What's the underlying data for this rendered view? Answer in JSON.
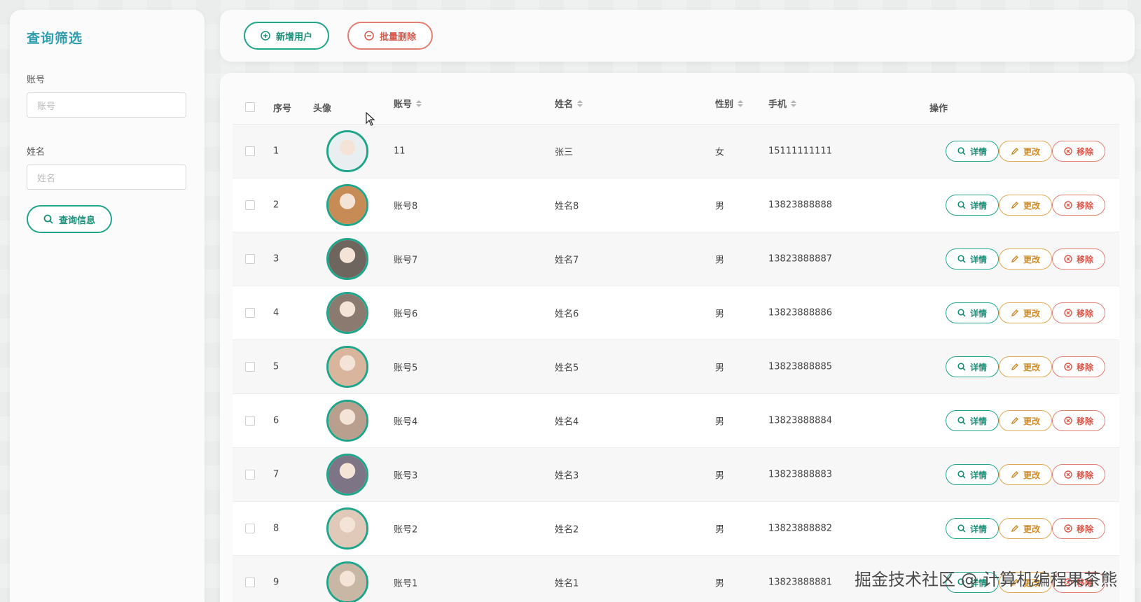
{
  "sidebar": {
    "title": "查询筛选",
    "account_label": "账号",
    "account_placeholder": "账号",
    "name_label": "姓名",
    "name_placeholder": "姓名",
    "query_button": "查询信息"
  },
  "toolbar": {
    "add_label": "新增用户",
    "batch_delete_label": "批量删除"
  },
  "table": {
    "columns": {
      "index": "序号",
      "avatar": "头像",
      "account": "账号",
      "name": "姓名",
      "gender": "性别",
      "phone": "手机",
      "actions": "操作"
    },
    "actions": {
      "view": "详情",
      "edit": "更改",
      "delete": "移除"
    },
    "rows": [
      {
        "index": "1",
        "account": "11",
        "name": "张三",
        "gender": "女",
        "phone": "15111111111",
        "avatar_color": "#e9eef0"
      },
      {
        "index": "2",
        "account": "账号8",
        "name": "姓名8",
        "gender": "男",
        "phone": "13823888888",
        "avatar_color": "#c78c55"
      },
      {
        "index": "3",
        "account": "账号7",
        "name": "姓名7",
        "gender": "男",
        "phone": "13823888887",
        "avatar_color": "#6d655e"
      },
      {
        "index": "4",
        "account": "账号6",
        "name": "姓名6",
        "gender": "男",
        "phone": "13823888886",
        "avatar_color": "#8a7a6f"
      },
      {
        "index": "5",
        "account": "账号5",
        "name": "姓名5",
        "gender": "男",
        "phone": "13823888885",
        "avatar_color": "#d8b59c"
      },
      {
        "index": "6",
        "account": "账号4",
        "name": "姓名4",
        "gender": "男",
        "phone": "13823888884",
        "avatar_color": "#b9a08e"
      },
      {
        "index": "7",
        "account": "账号3",
        "name": "姓名3",
        "gender": "男",
        "phone": "13823888883",
        "avatar_color": "#7d7586"
      },
      {
        "index": "8",
        "account": "账号2",
        "name": "姓名2",
        "gender": "男",
        "phone": "13823888882",
        "avatar_color": "#e0c9b8"
      },
      {
        "index": "9",
        "account": "账号1",
        "name": "姓名1",
        "gender": "男",
        "phone": "13823888881",
        "avatar_color": "#c9b7a5"
      }
    ]
  },
  "watermark": "掘金技术社区 @ 计算机编程果茶熊"
}
